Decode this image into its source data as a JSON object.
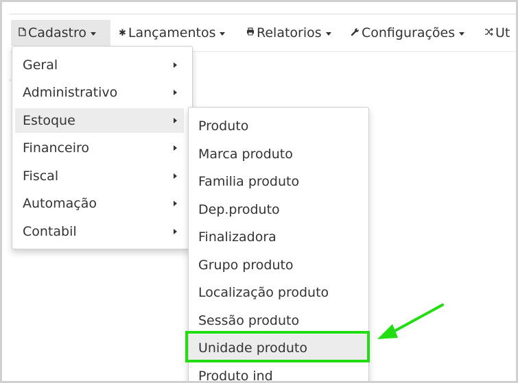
{
  "menubar": {
    "items": [
      {
        "label": "Cadastro",
        "icon": "document-icon"
      },
      {
        "label": "Lançamentos",
        "icon": "gear-icon"
      },
      {
        "label": "Relatorios",
        "icon": "printer-icon"
      },
      {
        "label": "Configurações",
        "icon": "wrench-icon"
      },
      {
        "label": "Ut",
        "icon": "shuffle-icon"
      }
    ]
  },
  "cadastro_menu": {
    "items": [
      {
        "label": "Geral"
      },
      {
        "label": "Administrativo"
      },
      {
        "label": "Estoque"
      },
      {
        "label": "Financeiro"
      },
      {
        "label": "Fiscal"
      },
      {
        "label": "Automação"
      },
      {
        "label": "Contabil"
      }
    ]
  },
  "estoque_menu": {
    "items": [
      {
        "label": "Produto"
      },
      {
        "label": "Marca produto"
      },
      {
        "label": "Familia produto"
      },
      {
        "label": "Dep.produto"
      },
      {
        "label": "Finalizadora"
      },
      {
        "label": "Grupo produto"
      },
      {
        "label": "Localização produto"
      },
      {
        "label": "Sessão produto"
      },
      {
        "label": "Unidade produto"
      },
      {
        "label": "Produto ind"
      }
    ]
  },
  "annotation": {
    "highlight_color": "#22dd11"
  }
}
